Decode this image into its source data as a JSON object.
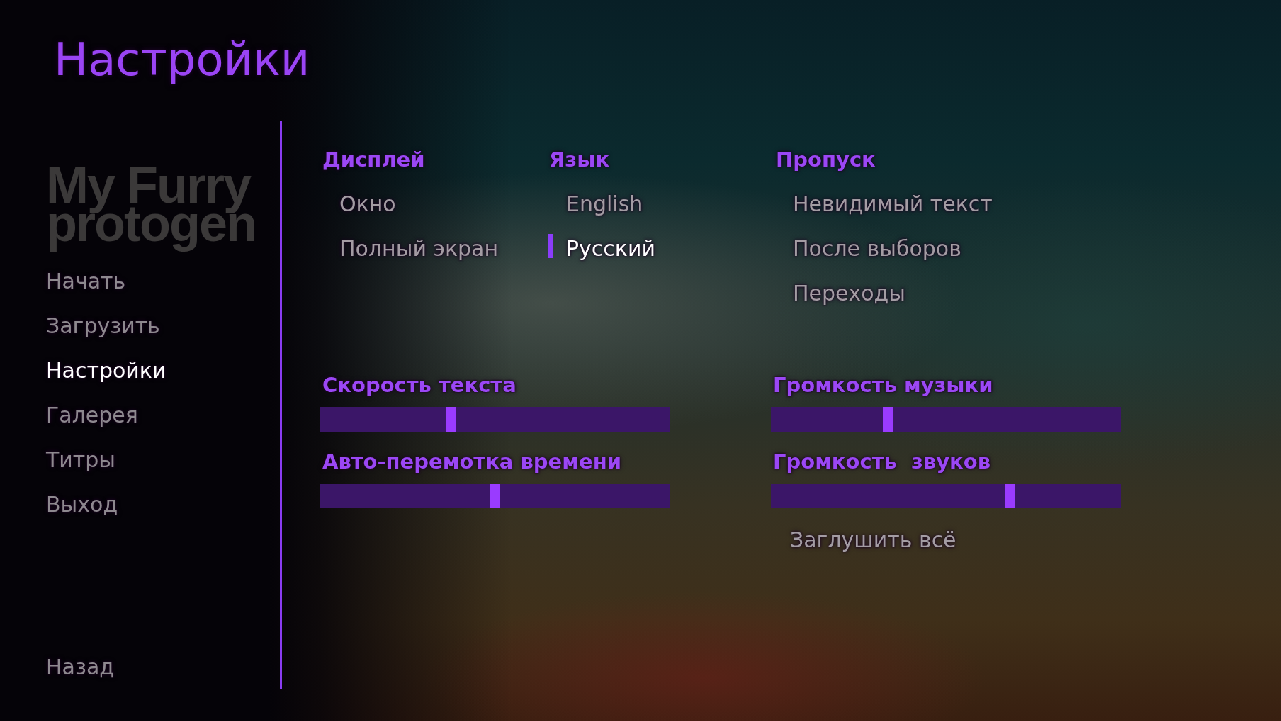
{
  "title": "Настройки",
  "logo": {
    "lines": [
      "My Furry",
      "protogen"
    ]
  },
  "main_menu": {
    "items": [
      {
        "label": "Начать",
        "selected": false
      },
      {
        "label": "Загрузить",
        "selected": false
      },
      {
        "label": "Настройки",
        "selected": true
      },
      {
        "label": "Галерея",
        "selected": false
      },
      {
        "label": "Титры",
        "selected": false
      },
      {
        "label": "Выход",
        "selected": false
      }
    ],
    "back": {
      "label": "Назад"
    }
  },
  "preferences": {
    "option_groups": [
      {
        "title": "Дисплей",
        "items": [
          {
            "label": "Окно",
            "selected": false
          },
          {
            "label": "Полный экран",
            "selected": false
          }
        ]
      },
      {
        "title": "Язык",
        "items": [
          {
            "label": "English",
            "selected": false
          },
          {
            "label": "Русский",
            "selected": true
          }
        ]
      },
      {
        "title": "Пропуск",
        "items": [
          {
            "label": "Невидимый текст",
            "checked": false
          },
          {
            "label": "После выборов",
            "checked": false
          },
          {
            "label": "Переходы",
            "checked": false
          }
        ]
      }
    ],
    "slider_columns": [
      {
        "sliders": [
          {
            "label": "Скорость текста",
            "level": 0.37
          },
          {
            "label": "Авто-перемотка времени",
            "level": 0.5
          }
        ]
      },
      {
        "sliders": [
          {
            "label": "Громкость музыки",
            "level": 0.33
          },
          {
            "label": "Громкость  звуков",
            "level": 0.69
          }
        ]
      }
    ],
    "mute_all": {
      "label": "Заглушить всё",
      "checked": false
    }
  }
}
